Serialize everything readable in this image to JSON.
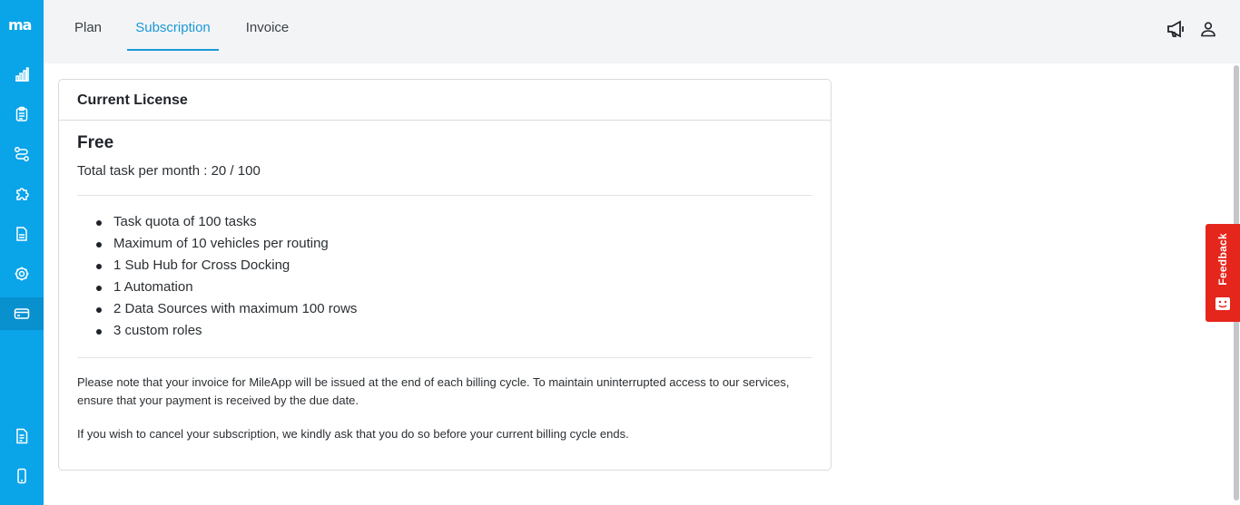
{
  "app": {
    "logo_text": "ma"
  },
  "tabs": [
    {
      "label": "Plan"
    },
    {
      "label": "Subscription"
    },
    {
      "label": "Invoice"
    }
  ],
  "sidebar": {
    "items": [
      {
        "name": "analytics-icon"
      },
      {
        "name": "clipboard-icon"
      },
      {
        "name": "route-icon"
      },
      {
        "name": "puzzle-icon"
      },
      {
        "name": "document-icon"
      },
      {
        "name": "settings-icon"
      },
      {
        "name": "billing-card-icon",
        "active": true
      },
      {
        "name": "docs-icon"
      },
      {
        "name": "mobile-icon"
      }
    ]
  },
  "license": {
    "header": "Current License",
    "plan_name": "Free",
    "task_usage": "Total task per month : 20 / 100",
    "features": [
      "Task quota of 100 tasks",
      "Maximum of 10 vehicles per routing",
      "1 Sub Hub for Cross Docking",
      "1 Automation",
      "2 Data Sources with maximum 100 rows",
      "3 custom roles"
    ],
    "note1": "Please note that your invoice for MileApp will be issued at the end of each billing cycle. To maintain uninterrupted access to our services, ensure that your payment is received by the due date.",
    "note2": "If you wish to cancel your subscription, we kindly ask that you do so before your current billing cycle ends."
  },
  "feedback": {
    "label": "Feedback"
  },
  "colors": {
    "sidebar": "#0aa4e8",
    "accent": "#1a9ad6",
    "feedback": "#e5261c"
  }
}
